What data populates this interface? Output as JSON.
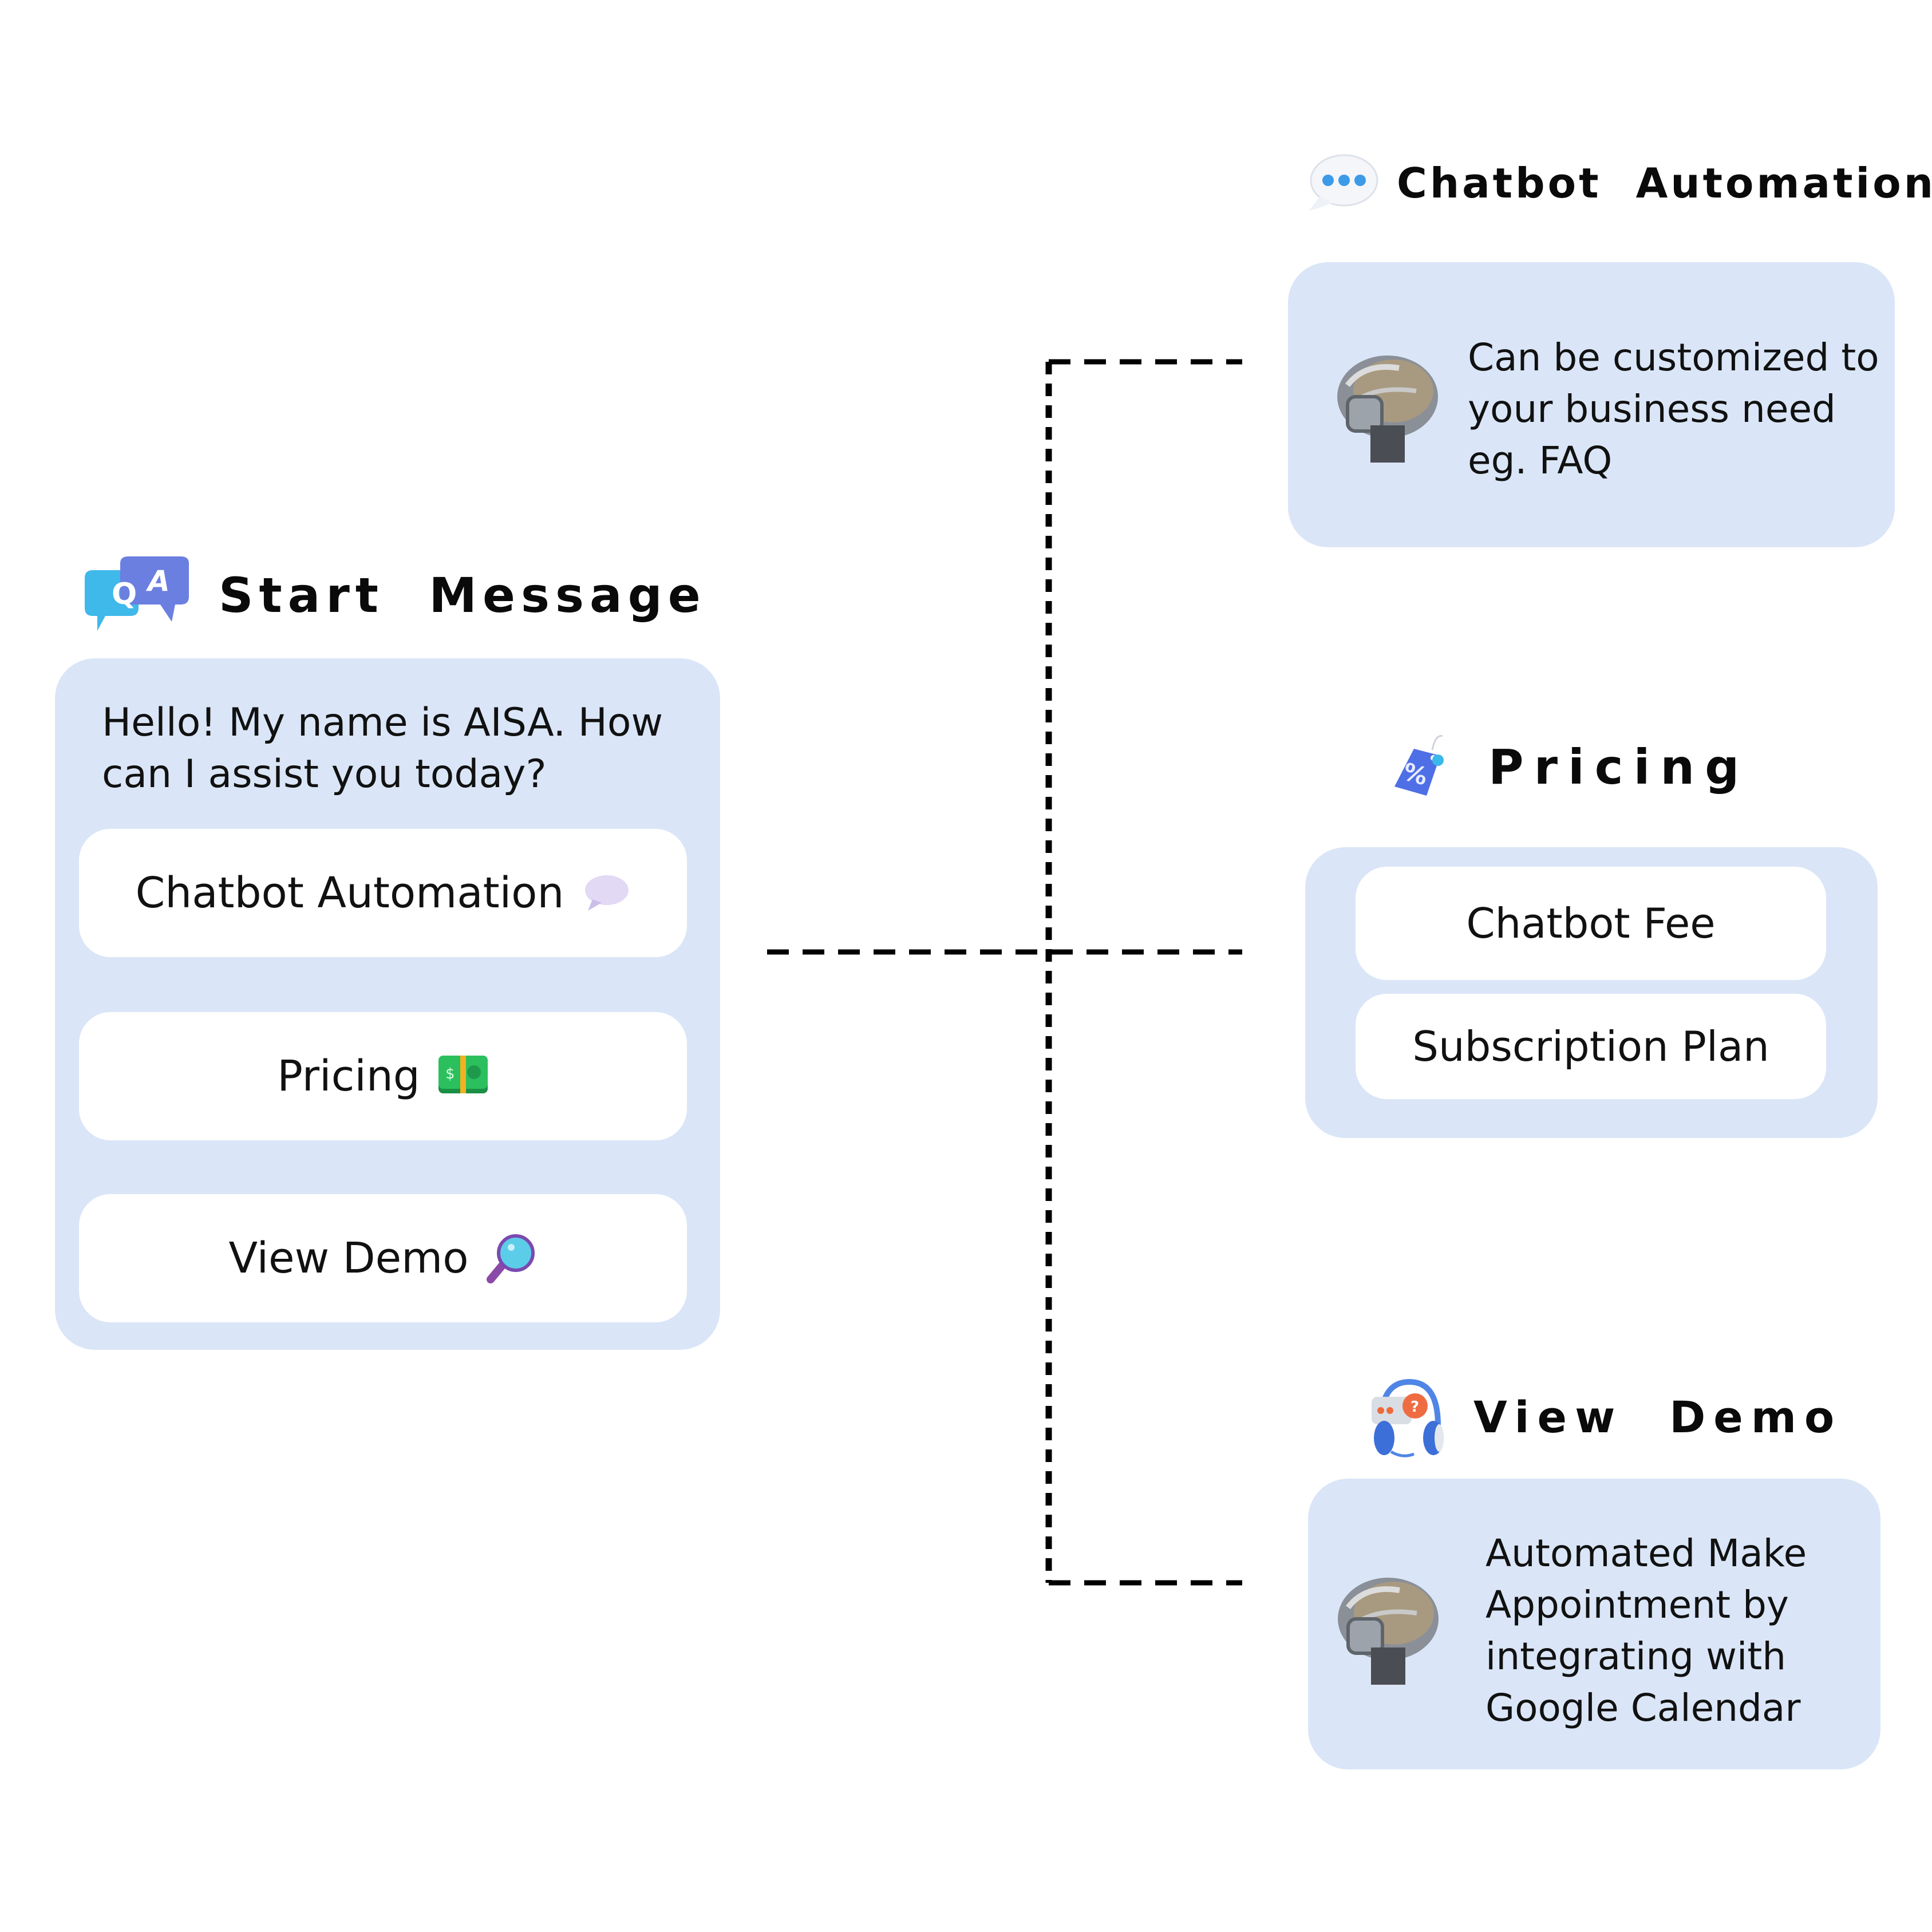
{
  "start_message": {
    "title": "Start  Message",
    "icon": "qa-chat-bubbles-icon",
    "greeting_line1": "Hello! My name is AISA. How",
    "greeting_line2": "can I assist you today?",
    "options": [
      {
        "label": "Chatbot Automation",
        "icon": "speech-bubble-icon"
      },
      {
        "label": "Pricing",
        "icon": "money-stack-icon"
      },
      {
        "label": "View Demo",
        "icon": "magnifying-glass-icon"
      }
    ]
  },
  "chatbot_automation": {
    "title": "Chatbot  Automation",
    "icon": "typing-bubble-icon",
    "description_lines": [
      "Can be customized to",
      "your business need",
      "eg. FAQ"
    ],
    "avatar": "robot-brain-icon"
  },
  "pricing": {
    "title": "Pricing",
    "icon": "price-tag-icon",
    "options": [
      {
        "label": "Chatbot Fee"
      },
      {
        "label": "Subscription Plan"
      }
    ]
  },
  "view_demo": {
    "title": "View  Demo",
    "icon": "headset-support-icon",
    "description_lines": [
      "Automated Make",
      "Appointment by",
      "integrating with",
      "Google Calendar"
    ],
    "avatar": "robot-brain-icon"
  },
  "colors": {
    "card_background": "#dae6f7",
    "pill_background": "#ffffff",
    "connector": "#000000",
    "text": "#111111"
  }
}
